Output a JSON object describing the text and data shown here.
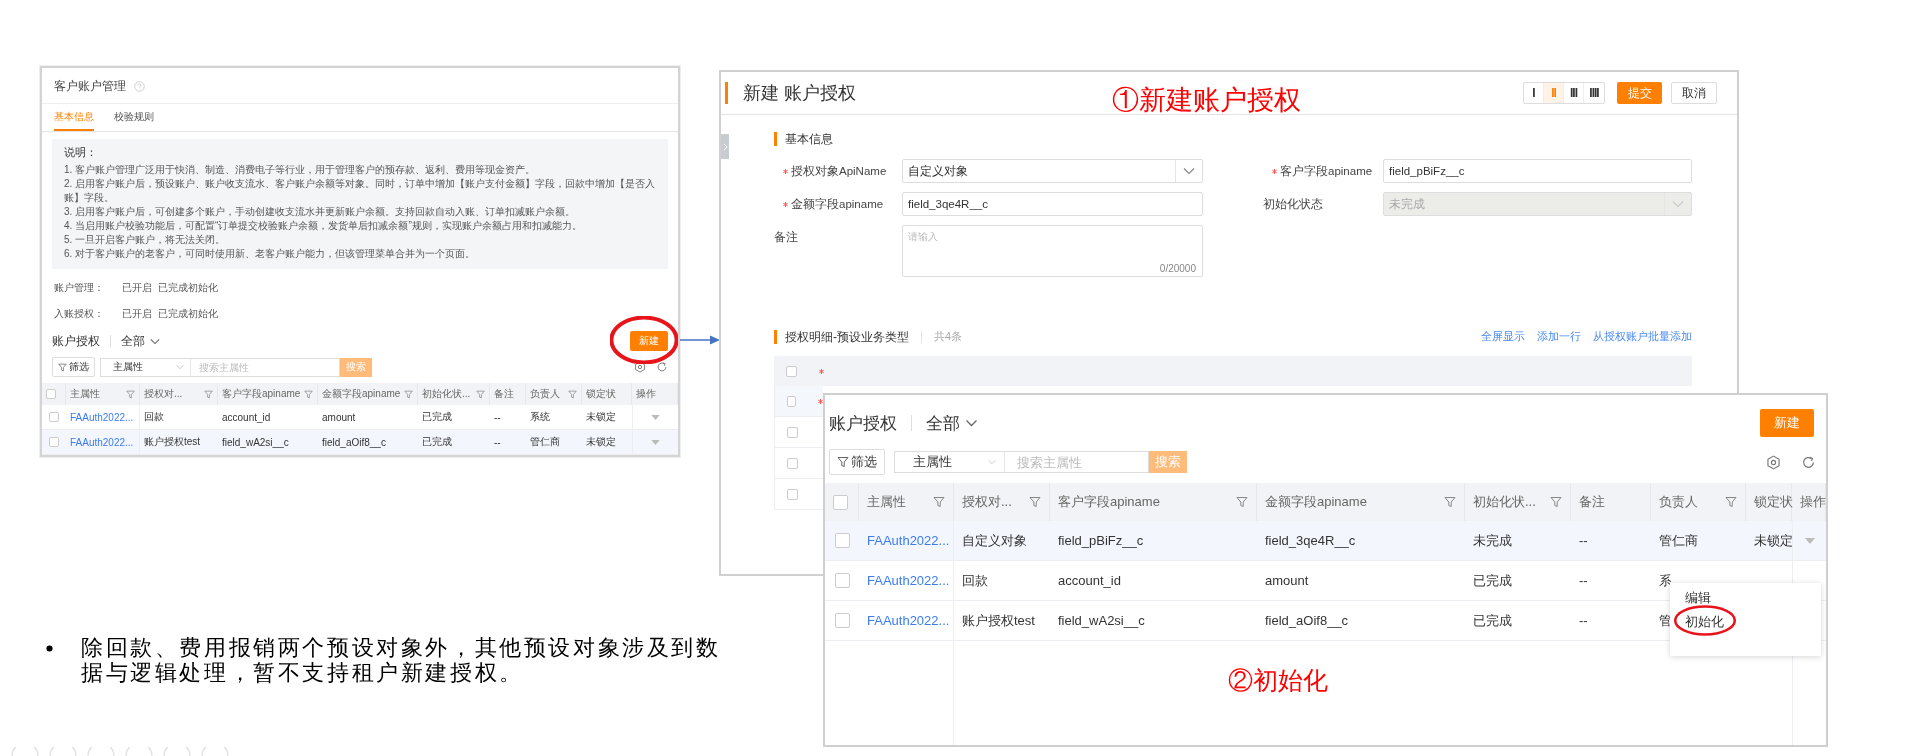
{
  "settings_page": {
    "title": "客户账户管理",
    "tabs": [
      {
        "label": "基本信息",
        "selected": true
      },
      {
        "label": "校验规则",
        "selected": false
      }
    ],
    "notice": {
      "heading": "说明：",
      "items": [
        "1. 客户账户管理广泛用于快消、制造、消费电子等行业，用于管理客户的预存款、返利、费用等现金资产。",
        "2. 启用客户账户后，预设账户、账户收支流水、客户账户余额等对象。同时，订单中增加【账户支付金额】字段，回款中增加【是否入账】字段。",
        "3. 启用客户账户后，可创建多个账户，手动创建收支流水并更新账户余额。支持回款自动入账、订单扣减账户余额。",
        "4. 当启用账户校验功能后，可配置“订单提交校验账户余额，发货单后扣减余额”规则，实现账户余额占用和扣减能力。",
        "5. 一旦开启客户账户，将无法关闭。",
        "6. 对于客户账户的老客户，可同时使用新、老客户账户能力，但该管理菜单合并为一个页面。"
      ]
    },
    "statuses": [
      {
        "label": "账户管理：",
        "values": [
          "已开启",
          "已完成初始化"
        ]
      },
      {
        "label": "入账授权：",
        "values": [
          "已开启",
          "已完成初始化"
        ]
      }
    ],
    "list": {
      "title": "账户授权",
      "view": "全部",
      "select_all_checked": false,
      "new_button": "新建",
      "new_button_circled": true,
      "filter_button": "筛选",
      "search_scope": "主属性",
      "search_placeholder": "搜索主属性",
      "search_button": "搜索",
      "columns": [
        {
          "label": "主属性",
          "filter": true
        },
        {
          "label": "授权对...",
          "filter": true
        },
        {
          "label": "客户字段apiname",
          "filter": true
        },
        {
          "label": "金额字段apiname",
          "filter": true
        },
        {
          "label": "初始化状...",
          "filter": true
        },
        {
          "label": "备注",
          "filter": false
        },
        {
          "label": "负责人",
          "filter": true
        },
        {
          "label": "锁定状",
          "filter": false
        },
        {
          "label": "操作",
          "filter": false
        }
      ],
      "rows": [
        {
          "checked": false,
          "highlighted": false,
          "action_caret": true,
          "cells": [
            "FAAuth2022...",
            "回款",
            "account_id",
            "amount",
            "已完成",
            "--",
            "系统",
            "未锁定"
          ]
        },
        {
          "checked": false,
          "highlighted": true,
          "action_caret": true,
          "cells": [
            "FAAuth2022...",
            "账户授权test",
            "field_wA2si__c",
            "field_aOif8__c",
            "已完成",
            "--",
            "管仁商",
            "未锁定"
          ]
        }
      ]
    }
  },
  "dialog": {
    "title": "新建 账户授权",
    "layout_options": [
      {
        "label": "I",
        "selected": false
      },
      {
        "label": "II",
        "selected": true
      },
      {
        "label": "III",
        "selected": false
      },
      {
        "label": "IIII",
        "selected": false
      }
    ],
    "submit": "提交",
    "cancel": "取消",
    "section": "基本信息",
    "fields": [
      {
        "kind": "select",
        "label": "授权对象ApiName",
        "required": true,
        "disabled": false,
        "value": "自定义对象"
      },
      {
        "kind": "text",
        "label": "客户字段apiname",
        "required": true,
        "disabled": false,
        "value": "field_pBiFz__c"
      },
      {
        "kind": "text",
        "label": "金额字段apiname",
        "required": true,
        "disabled": false,
        "value": "field_3qe4R__c"
      },
      {
        "kind": "select",
        "label": "初始化状态",
        "required": false,
        "disabled": true,
        "value": "未完成"
      },
      {
        "kind": "textarea",
        "label": "备注",
        "required": false,
        "disabled": false,
        "placeholder": "请输入",
        "counter": "0/20000"
      }
    ],
    "detail": {
      "title": "授权明细-预设业务类型",
      "count": "共4条",
      "actions": [
        "全屏显示",
        "添加一行",
        "从授权账户批量添加"
      ],
      "header_required": true,
      "header_checked": false,
      "rows": [
        {
          "required": true,
          "checked": false
        },
        {
          "required": false,
          "checked": false
        },
        {
          "required": false,
          "checked": false
        },
        {
          "required": false,
          "checked": false
        }
      ]
    }
  },
  "list_panel": {
    "title": "账户授权",
    "view": "全部",
    "select_all_checked": false,
    "new_button": "新建",
    "filter_button": "筛选",
    "search_scope": "主属性",
    "search_placeholder": "搜索主属性",
    "search_button": "搜索",
    "columns": [
      {
        "label": "主属性",
        "filter": true
      },
      {
        "label": "授权对...",
        "filter": true
      },
      {
        "label": "客户字段apiname",
        "filter": true
      },
      {
        "label": "金额字段apiname",
        "filter": true
      },
      {
        "label": "初始化状...",
        "filter": true
      },
      {
        "label": "备注",
        "filter": false
      },
      {
        "label": "负责人",
        "filter": true
      },
      {
        "label": "锁定状",
        "filter": false
      },
      {
        "label": "操作",
        "filter": false
      }
    ],
    "rows": [
      {
        "checked": false,
        "highlighted": true,
        "action_caret": true,
        "cells": [
          "FAAuth2022...",
          "自定义对象",
          "field_pBiFz__c",
          "field_3qe4R__c",
          "未完成",
          "--",
          "管仁商",
          "未锁定"
        ]
      },
      {
        "checked": false,
        "highlighted": false,
        "action_caret": false,
        "cells": [
          "FAAuth2022...",
          "回款",
          "account_id",
          "amount",
          "已完成",
          "--",
          "系"
        ]
      },
      {
        "checked": false,
        "highlighted": false,
        "action_caret": false,
        "cells": [
          "FAAuth2022...",
          "账户授权test",
          "field_wA2si__c",
          "field_aOif8__c",
          "已完成",
          "--",
          "管"
        ]
      }
    ],
    "menu": {
      "items": [
        {
          "label": "编辑",
          "circled": false
        },
        {
          "label": "初始化",
          "circled": true
        }
      ]
    }
  },
  "annotations": [
    "①新建账户授权",
    "②初始化"
  ],
  "bullets": [
    "除回款、费用报销两个预设对象外，其他预设对象涉及到数据与逻辑处理，暂不支持租户新建授权。"
  ]
}
